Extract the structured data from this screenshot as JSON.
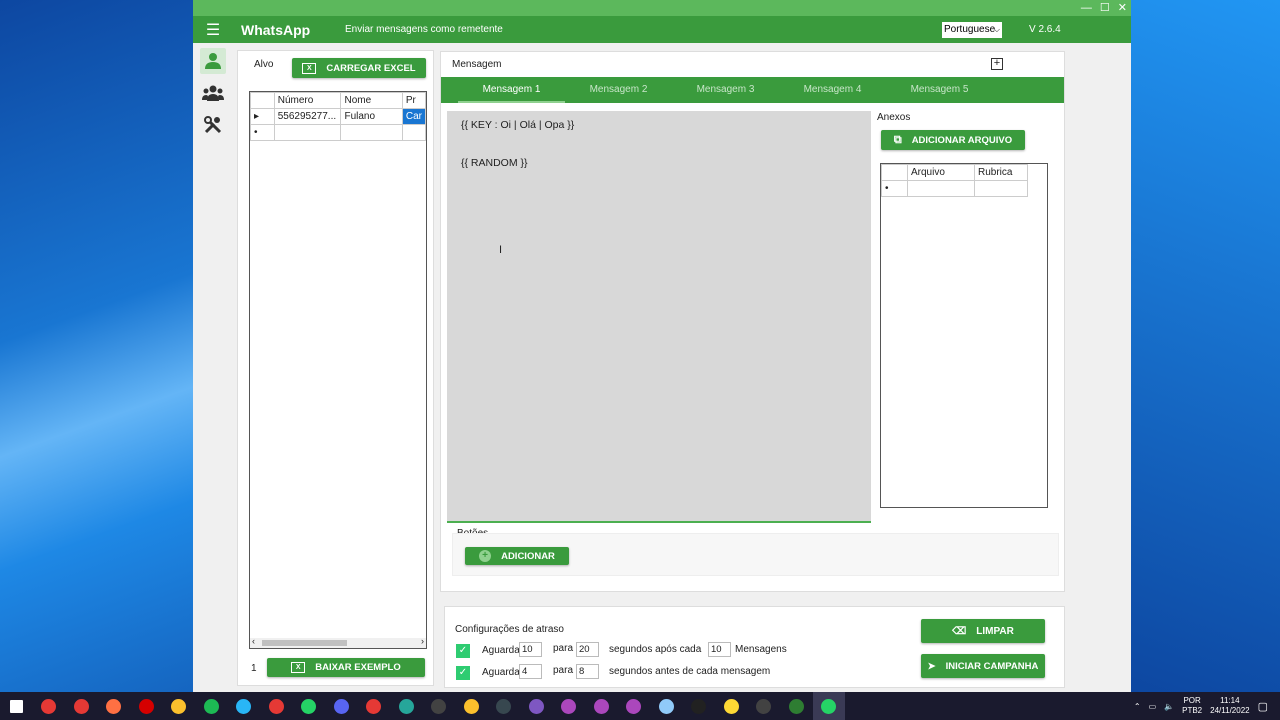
{
  "app": {
    "brand": "WhatsApp",
    "subtitle": "Enviar mensagens como remetente",
    "language": "Portuguese",
    "version": "V 2.6.4",
    "accent": "#3a9b3d"
  },
  "target": {
    "title": "Alvo",
    "load_excel": "CARREGAR EXCEL",
    "columns": [
      "Número",
      "Nome",
      "Pr"
    ],
    "rows": [
      [
        "556295277...",
        "Fulano",
        "Car"
      ]
    ],
    "count": "1",
    "download_example": "BAIXAR EXEMPLO"
  },
  "message": {
    "title": "Mensagem",
    "tabs": [
      "Mensagem 1",
      "Mensagem 2",
      "Mensagem 3",
      "Mensagem 4",
      "Mensagem 5"
    ],
    "active_tab": "Mensagem 1",
    "line1": "{{ KEY : Oi | Olá | Opa }}",
    "line2": "{{ RANDOM }}",
    "attachments_title": "Anexos",
    "add_file": "ADICIONAR ARQUIVO",
    "attach_columns": [
      "Arquivo",
      "Rubrica"
    ],
    "buttons_title": "Botões",
    "add_button": "ADICIONAR"
  },
  "delay": {
    "title": "Configurações de atraso",
    "row1": {
      "wait": "Aguarda",
      "from": "10",
      "to_label": "para",
      "to": "20",
      "after": "segundos após cada",
      "count": "10",
      "unit": "Mensagens"
    },
    "row2": {
      "wait": "Aguarda",
      "from": "4",
      "to_label": "para",
      "to": "8",
      "after": "segundos antes de cada mensagem"
    },
    "clear": "LIMPAR",
    "start": "INICIAR CAMPANHA"
  },
  "taskbar": {
    "lang1": "POR",
    "lang2": "PTB2",
    "time": "11:14",
    "date": "24/11/2022",
    "icons": [
      "windows-icon",
      "chrome-icon",
      "chrome-icon",
      "firefox-icon",
      "opera-icon",
      "folder-icon",
      "spotify-icon",
      "telegram-icon",
      "anydesk-icon",
      "whatsapp-icon",
      "discord-icon",
      "chrome-icon",
      "edge-icon",
      "obs-icon",
      "files-icon",
      "chat-icon",
      "app-icon",
      "brave-icon",
      "brave-icon",
      "brave-icon",
      "notepad-icon",
      "hs-icon",
      "app2-icon",
      "search-app-icon",
      "excel-icon",
      "whatsapp-icon"
    ],
    "icon_colors": [
      "#ffffff",
      "#e53935",
      "#e53935",
      "#ff7043",
      "#d50000",
      "#fbc02d",
      "#1db954",
      "#29b6f6",
      "#e53935",
      "#25d366",
      "#5865f2",
      "#e53935",
      "#26a69a",
      "#424242",
      "#fbc02d",
      "#37474f",
      "#7e57c2",
      "#ab47bc",
      "#ab47bc",
      "#ab47bc",
      "#90caf9",
      "#212121",
      "#fdd835",
      "#424242",
      "#2e7d32",
      "#25d366"
    ]
  }
}
